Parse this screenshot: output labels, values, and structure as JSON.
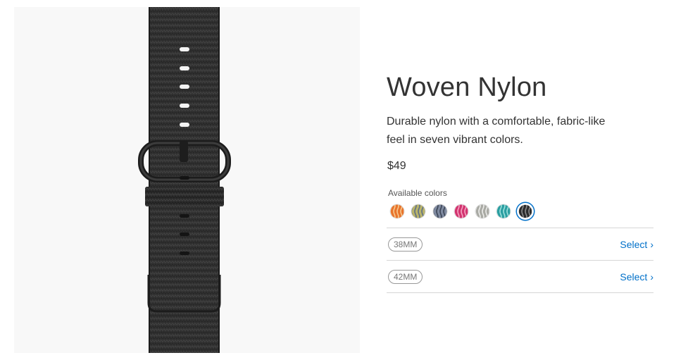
{
  "product": {
    "title": "Woven Nylon",
    "description": "Durable nylon with a comfortable, fabric-like feel in seven vibrant colors.",
    "price": "$49",
    "image_alt": "Black woven nylon watch band"
  },
  "colors": {
    "label": "Available colors",
    "swatches": [
      {
        "name": "orange-swatch",
        "base": "#e8742c",
        "stripe": "#f6c98f"
      },
      {
        "name": "yellow-gray-swatch",
        "base": "#b9b46a",
        "stripe": "#5d6f87"
      },
      {
        "name": "blue-gray-swatch",
        "base": "#7f8aa0",
        "stripe": "#3c4555"
      },
      {
        "name": "pink-swatch",
        "base": "#d2336f",
        "stripe": "#f4a3c1"
      },
      {
        "name": "gray-swatch",
        "base": "#a9aaa4",
        "stripe": "#ececea"
      },
      {
        "name": "teal-swatch",
        "base": "#2a9ea1",
        "stripe": "#9fe0dc"
      },
      {
        "name": "black-swatch",
        "base": "#2c2c2c",
        "stripe": "#8a8a8a"
      }
    ],
    "selected_index": 6
  },
  "sizes": [
    {
      "label": "38MM",
      "action": "Select"
    },
    {
      "label": "42MM",
      "action": "Select"
    }
  ],
  "theme": {
    "link_color": "#0070c9",
    "band_color": "#2b2b2b"
  }
}
